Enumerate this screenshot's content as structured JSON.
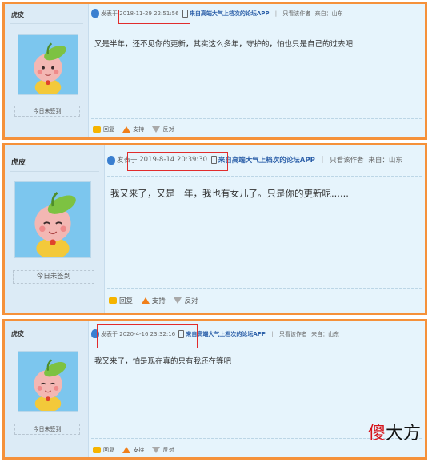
{
  "posts": [
    {
      "username": "虎皮",
      "sign_label": "今日未签到",
      "posted_label": "发表于",
      "datetime": "2018-11-29 22:51:56",
      "app_label": "来自高端大气上档次的论坛APP",
      "only_author": "只看该作者",
      "location": "来自：山东",
      "content": "又是半年，还不见你的更新，其实这么多年，守护的，怕也只是自己的过去吧",
      "reply": "回复",
      "support": "支持",
      "oppose": "反对"
    },
    {
      "username": "虎皮",
      "sign_label": "今日未签到",
      "posted_label": "发表于",
      "datetime": "2019-8-14 20:39:30",
      "app_label": "来自高端大气上档次的论坛APP",
      "only_author": "只看该作者",
      "location": "来自：山东",
      "content": "我又来了，又是一年，我也有女儿了。只是你的更新呢......",
      "reply": "回复",
      "support": "支持",
      "oppose": "反对"
    },
    {
      "username": "虎皮",
      "sign_label": "今日未签到",
      "posted_label": "发表于",
      "datetime": "2020-4-16 23:32:16",
      "app_label": "来自高端大气上档次的论坛APP",
      "only_author": "只看该作者",
      "location": "来自：山东",
      "content": "我又来了，怕是现在真的只有我还在等吧",
      "reply": "回复",
      "support": "支持",
      "oppose": "反对"
    }
  ],
  "watermark": {
    "red": "傻",
    "black": "大方"
  },
  "colors": {
    "frame": "#f5913a",
    "highlight": "#e12c2c",
    "app_link": "#2a5ea8"
  }
}
